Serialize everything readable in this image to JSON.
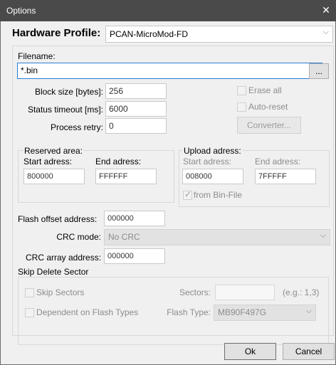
{
  "window": {
    "title": "Options",
    "close_glyph": "✕"
  },
  "hardware_profile": {
    "label": "Hardware Profile:",
    "value": "PCAN-MicroMod-FD"
  },
  "filename": {
    "label": "Filename:",
    "value": "*.bin",
    "browse_label": "..."
  },
  "block_size": {
    "label": "Block size [bytes]:",
    "value": "256"
  },
  "status_timeout": {
    "label": "Status timeout [ms]:",
    "value": "6000"
  },
  "process_retry": {
    "label": "Process retry:",
    "value": "0"
  },
  "erase_all": {
    "label": "Erase all"
  },
  "auto_reset": {
    "label": "Auto-reset"
  },
  "converter": {
    "label": "Converter..."
  },
  "reserved_area": {
    "title": "Reserved area:",
    "start_label": "Start adress:",
    "start_value": "800000",
    "end_label": "End adress:",
    "end_value": "FFFFFF"
  },
  "upload_adress": {
    "title": "Upload adress:",
    "start_label": "Start adress:",
    "start_value": "008000",
    "end_label": "End adress:",
    "end_value": "7FFFFF",
    "from_bin_label": "from Bin-File",
    "from_bin_checked": true
  },
  "flash_offset": {
    "label": "Flash offset address:",
    "value": "000000"
  },
  "crc_mode": {
    "label": "CRC mode:",
    "value": "No CRC"
  },
  "crc_array": {
    "label": "CRC array address:",
    "value": "000000"
  },
  "skip_delete": {
    "title": "Skip Delete Sector",
    "skip_sectors_label": "Skip Sectors",
    "sectors_label": "Sectors:",
    "sectors_value": "",
    "sectors_hint": "(e.g.: 1,3)",
    "dependent_label": "Dependent on Flash Types",
    "flash_type_label": "Flash Type:",
    "flash_type_value": "MB90F497G"
  },
  "buttons": {
    "ok": "Ok",
    "cancel": "Cancel"
  }
}
